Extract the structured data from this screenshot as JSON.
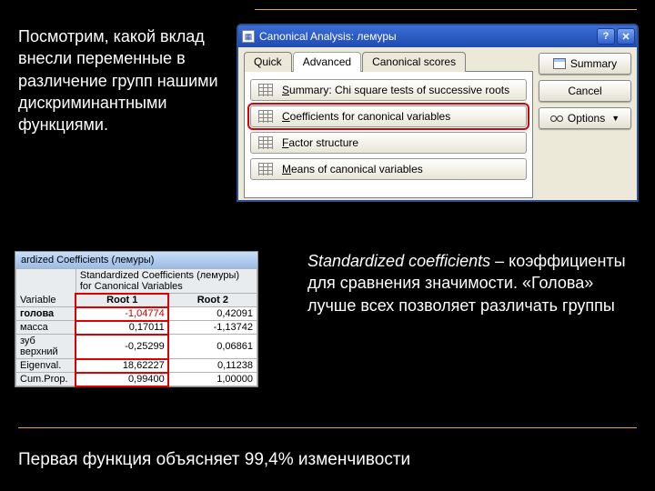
{
  "paragraphs": {
    "intro": "Посмотрим, какой вклад внесли переменные в различение групп нашими дискриминантными функциями.",
    "stdcoef_italic": "Standardized coefficients",
    "stdcoef_rest": " – коэффициенты для сравнения значимости. «Голова» лучше всех позволяет различать группы",
    "footer": "Первая функция объясняет 99,4% изменчивости"
  },
  "dialog": {
    "title": "Canonical Analysis: лемуры",
    "window_buttons": {
      "help": "?",
      "close": "✕"
    },
    "tabs": [
      "Quick",
      "Advanced",
      "Canonical scores"
    ],
    "active_tab": 1,
    "rows": [
      {
        "label_pre": "",
        "ul": "S",
        "label_post": "ummary: Chi square tests of successive roots",
        "highlight": false
      },
      {
        "label_pre": "",
        "ul": "C",
        "label_post": "oefficients for canonical variables",
        "highlight": true
      },
      {
        "label_pre": "",
        "ul": "F",
        "label_post": "actor structure",
        "highlight": false
      },
      {
        "label_pre": "",
        "ul": "M",
        "label_post": "eans of canonical variables",
        "highlight": false
      }
    ],
    "side": {
      "summary": "Summary",
      "cancel": "Cancel",
      "options": "Options"
    }
  },
  "coef": {
    "win_title": "ardized Coefficients (лемуры)",
    "header_main": "Standardized Coefficients (лемуры) for Canonical Variables",
    "col_var": "Variable",
    "cols": [
      "Root 1",
      "Root 2"
    ],
    "rows": [
      {
        "name": "голова",
        "bold": true,
        "vals": [
          "-1,04774",
          "0,42091"
        ],
        "r1red": true
      },
      {
        "name": "масса",
        "bold": false,
        "vals": [
          "0,17011",
          "-1,13742"
        ],
        "r1red": false
      },
      {
        "name": "зуб верхний",
        "bold": false,
        "vals": [
          "-0,25299",
          "0,06861"
        ],
        "r1red": false
      },
      {
        "name": "Eigenval.",
        "bold": false,
        "vals": [
          "18,62227",
          "0,11238"
        ],
        "r1red": false
      },
      {
        "name": "Cum.Prop.",
        "bold": false,
        "vals": [
          "0,99400",
          "1,00000"
        ],
        "r1red": false
      }
    ]
  }
}
